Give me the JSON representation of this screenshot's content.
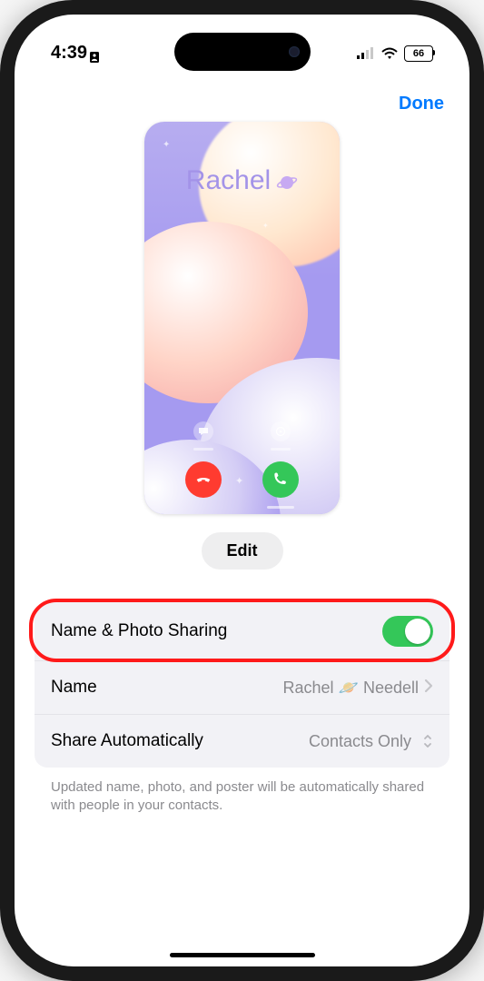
{
  "status_bar": {
    "time": "4:39",
    "battery_percent": "66"
  },
  "header": {
    "done_label": "Done"
  },
  "poster": {
    "display_name": "Rachel"
  },
  "edit_button_label": "Edit",
  "settings": {
    "sharing_toggle_label": "Name & Photo Sharing",
    "sharing_toggle_on": true,
    "name_row_label": "Name",
    "name_value": "Rachel 🪐 Needell",
    "share_auto_label": "Share Automatically",
    "share_auto_value": "Contacts Only"
  },
  "footer_text": "Updated name, photo, and poster will be automatically shared with people in your contacts.",
  "colors": {
    "accent": "#007aff",
    "toggle_on": "#34c759",
    "highlight": "#ff1a1a"
  }
}
